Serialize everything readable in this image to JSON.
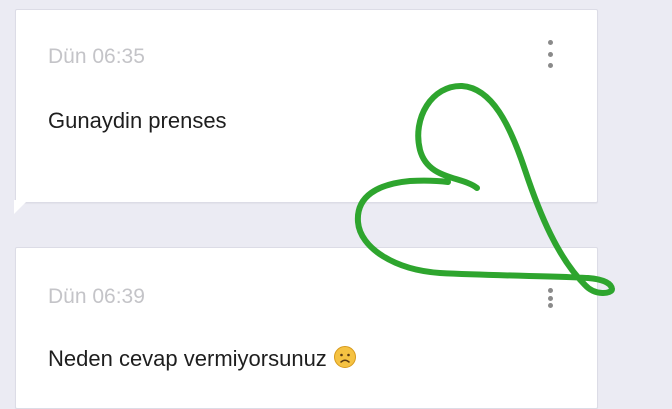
{
  "messages": [
    {
      "time": "Dün 06:35",
      "text": "Gunaydin prenses"
    },
    {
      "time": "Dün 06:39",
      "text": "Neden cevap vermiyorsunuz",
      "emoji": "frowning-face"
    }
  ],
  "colors": {
    "background": "#ebebf3",
    "card": "#ffffff",
    "timestamp": "#c4c4c8",
    "text": "#1e1e1e",
    "heart_stroke": "#2ea52e",
    "emoji_fill": "#f5c242"
  }
}
